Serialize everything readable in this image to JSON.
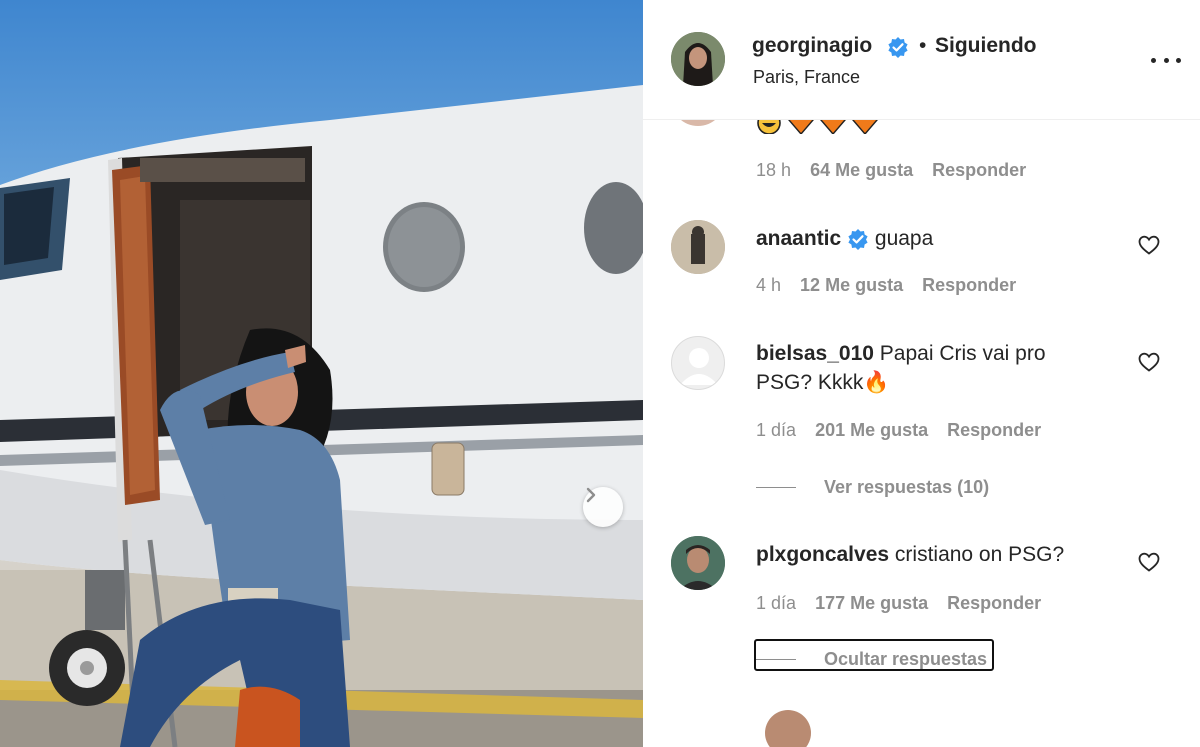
{
  "post": {
    "image_alt": "Woman in denim outfit posing on the steps of a private jet",
    "next_icon": "chevron-right-icon"
  },
  "header": {
    "username": "georginagio",
    "separator": "•",
    "follow_status": "Siguiendo",
    "location": "Paris, France",
    "more_icon": "more-horizontal-icon"
  },
  "comments": [
    {
      "username": "",
      "text": "",
      "emoji_icons": [
        "grinning-face-icon",
        "orange-diamond-icon",
        "orange-diamond-icon",
        "orange-diamond-icon"
      ],
      "time": "18 h",
      "likes": "64 Me gusta",
      "reply": "Responder"
    },
    {
      "username": "anaantic",
      "verified": true,
      "text": "guapa",
      "time": "4 h",
      "likes": "12 Me gusta",
      "reply": "Responder"
    },
    {
      "username": "bielsas_010",
      "text": "Papai Cris vai pro PSG? Kkkk",
      "emoji": "🔥",
      "time": "1 día",
      "likes": "201 Me gusta",
      "reply": "Responder",
      "view_replies": "Ver respuestas (10)"
    },
    {
      "username": "plxgoncalves",
      "text": "cristiano on PSG?",
      "time": "1 día",
      "likes": "177 Me gusta",
      "reply": "Responder",
      "hide_replies": "Ocultar respuestas"
    }
  ],
  "colors": {
    "verified": "#3897f0",
    "meta_gray": "#8e8e8e",
    "text": "#262626"
  }
}
